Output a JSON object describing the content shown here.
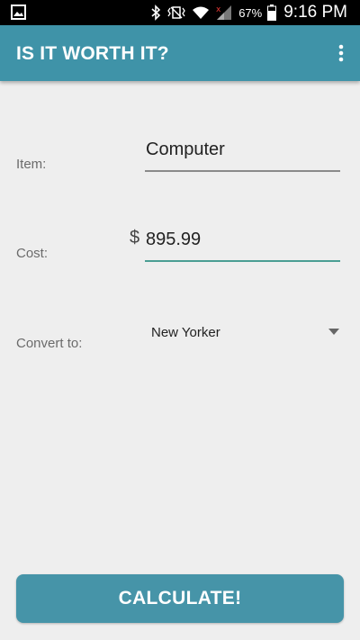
{
  "status_bar": {
    "battery_percent": "67%",
    "time": "9:16 PM",
    "icons": [
      "gallery-icon",
      "bluetooth-icon",
      "vibrate-icon",
      "wifi-icon",
      "signal-icon",
      "battery-icon"
    ]
  },
  "app_bar": {
    "title": "IS IT WORTH IT?",
    "overflow_icon": "overflow-menu-icon",
    "color": "#3f93a8"
  },
  "form": {
    "item_label": "Item:",
    "item_value": "Computer",
    "cost_label": "Cost:",
    "currency_symbol": "$",
    "cost_value": "895.99",
    "convert_label": "Convert to:",
    "convert_selected": "New Yorker"
  },
  "actions": {
    "calculate_label": "CALCULATE!"
  },
  "colors": {
    "accent": "#3f93a8",
    "background": "#eeeeee",
    "focused_underline": "#4a9e93"
  }
}
